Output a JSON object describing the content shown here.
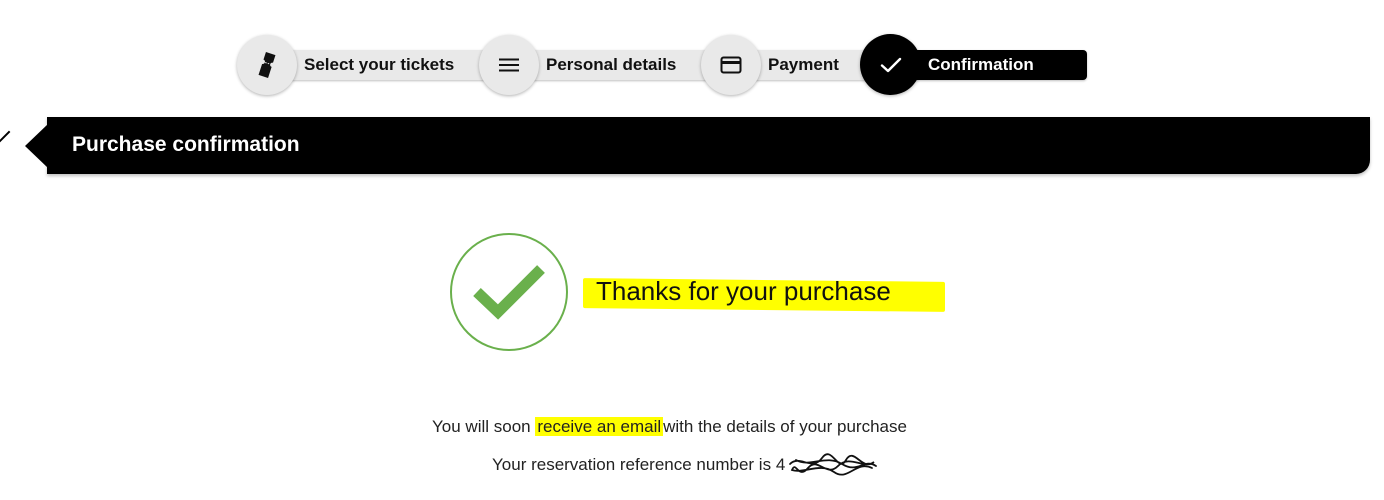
{
  "stepper": {
    "steps": [
      {
        "label": "Select your tickets",
        "icon": "ticket-icon",
        "state": "done"
      },
      {
        "label": "Personal details",
        "icon": "menu-lines-icon",
        "state": "done"
      },
      {
        "label": "Payment",
        "icon": "credit-card-icon",
        "state": "done"
      },
      {
        "label": "Confirmation",
        "icon": "checkmark-icon",
        "state": "active"
      }
    ]
  },
  "header": {
    "title": "Purchase confirmation"
  },
  "confirmation": {
    "thanks": "Thanks for your purchase",
    "email_prefix": "You will soon",
    "email_highlight": "receive an email",
    "email_suffix": "with the details of your purchase",
    "reference_prefix": "Your reservation reference number is",
    "reference_visible": "4"
  },
  "colors": {
    "accent": "#000000",
    "step_inactive": "#e9e9e9",
    "success": "#6ab04c",
    "highlight": "#ffff00"
  }
}
